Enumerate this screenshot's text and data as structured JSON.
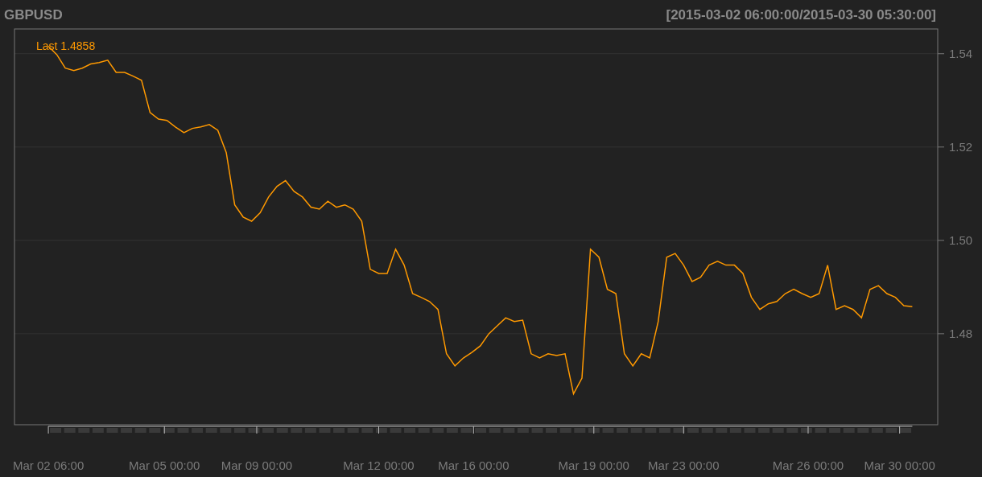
{
  "range": "[2015-03-02 06:00:00/2015-03-30 05:30:00]",
  "chart_data": {
    "type": "line",
    "title": "GBPUSD",
    "annotations": [
      "Last 1.4858"
    ],
    "grid": true,
    "ylim": [
      1.4605,
      1.5453
    ],
    "yticks": [
      {
        "value": 1.48,
        "label": "1.48"
      },
      {
        "value": 1.5,
        "label": "1.50"
      },
      {
        "value": 1.52,
        "label": "1.52"
      },
      {
        "value": 1.54,
        "label": "1.54"
      }
    ],
    "series": [
      {
        "color": "#ff9900",
        "values": [
          1.5416,
          1.5398,
          1.5369,
          1.5364,
          1.5369,
          1.5378,
          1.5381,
          1.5386,
          1.536,
          1.536,
          1.5352,
          1.5343,
          1.5274,
          1.526,
          1.5257,
          1.5243,
          1.5231,
          1.524,
          1.5243,
          1.5248,
          1.5236,
          1.5188,
          1.5076,
          1.505,
          1.5041,
          1.5059,
          1.5093,
          1.5116,
          1.5128,
          1.5105,
          1.5093,
          1.5071,
          1.5067,
          1.5084,
          1.5071,
          1.5076,
          1.5067,
          1.5041,
          1.4938,
          1.4929,
          1.4929,
          1.4981,
          1.4947,
          1.4886,
          1.4878,
          1.4869,
          1.4852,
          1.4757,
          1.4731,
          1.4748,
          1.476,
          1.4774,
          1.48,
          1.4817,
          1.4834,
          1.4826,
          1.4829,
          1.4757,
          1.4748,
          1.4757,
          1.4753,
          1.4757,
          1.4671,
          1.4705,
          1.4981,
          1.4964,
          1.4895,
          1.4886,
          1.4757,
          1.4731,
          1.4757,
          1.4748,
          1.4826,
          1.4964,
          1.4972,
          1.4947,
          1.4912,
          1.4921,
          1.4947,
          1.4955,
          1.4947,
          1.4947,
          1.4929,
          1.4878,
          1.4852,
          1.4864,
          1.4869,
          1.4886,
          1.4895,
          1.4886,
          1.4878,
          1.4886,
          1.4947,
          1.4852,
          1.486,
          1.4852,
          1.4834,
          1.4895,
          1.4903,
          1.4886,
          1.4878,
          1.486,
          1.4858
        ]
      }
    ]
  },
  "x_axis_labels": [
    "Mar 02 06:00",
    "Mar 05 00:00",
    "Mar 09 00:00",
    "Mar 12 00:00",
    "Mar 16 00:00",
    "Mar 19 00:00",
    "Mar 23 00:00",
    "Mar 26 00:00",
    "Mar 30 00:00"
  ]
}
